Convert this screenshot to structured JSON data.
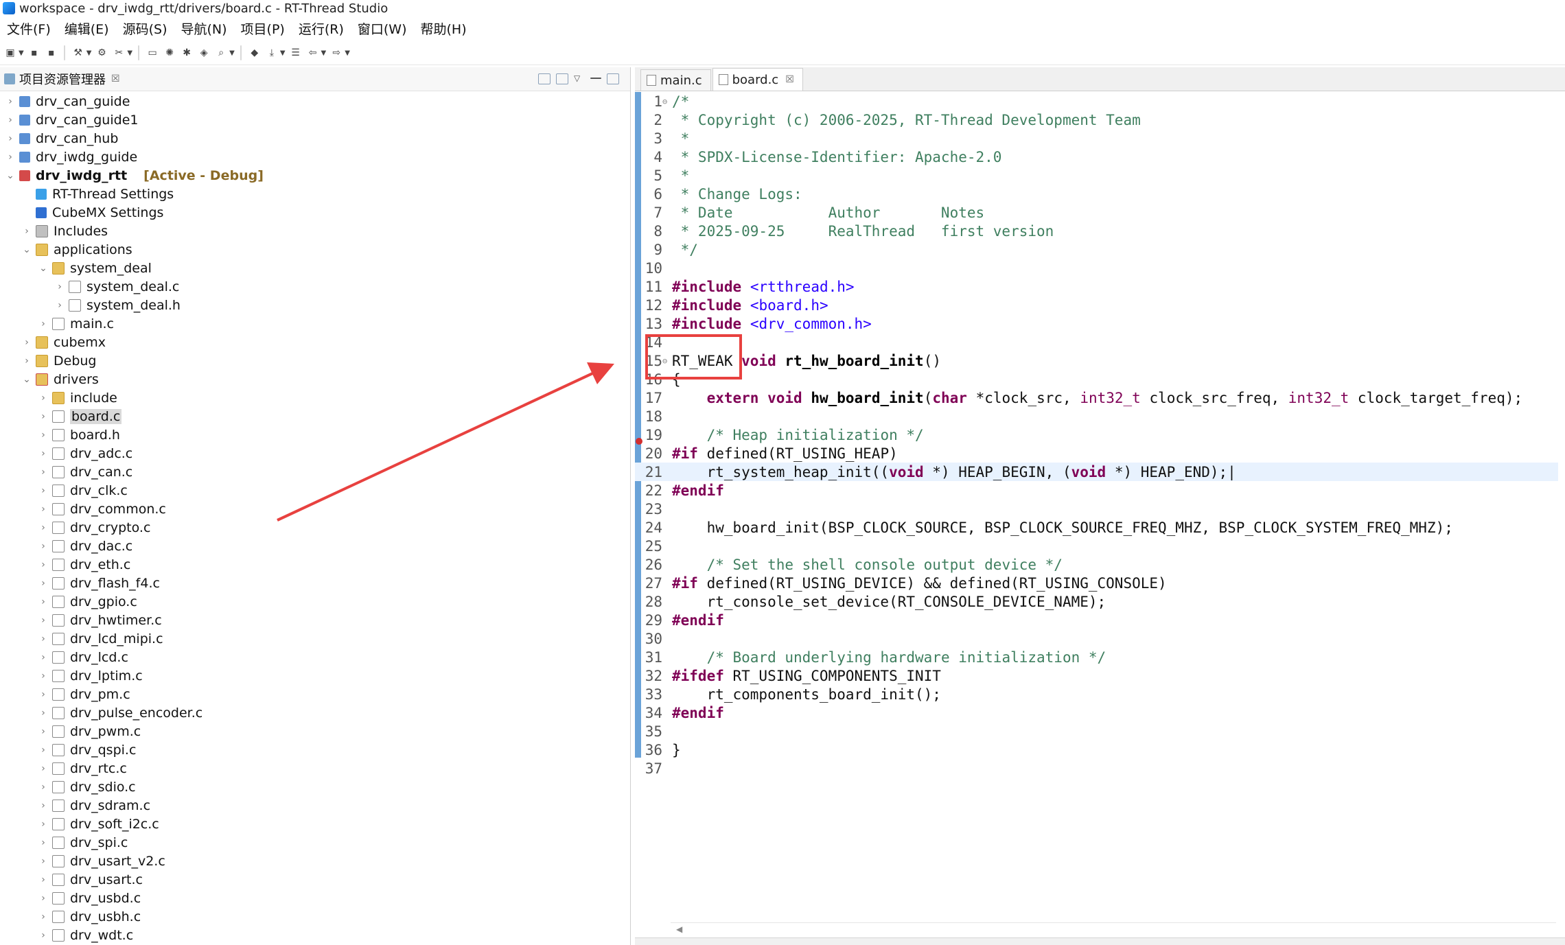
{
  "window": {
    "title": "workspace - drv_iwdg_rtt/drivers/board.c - RT-Thread Studio"
  },
  "menu": [
    "文件(F)",
    "编辑(E)",
    "源码(S)",
    "导航(N)",
    "项目(P)",
    "运行(R)",
    "窗口(W)",
    "帮助(H)"
  ],
  "explorer": {
    "title": "项目资源管理器",
    "close": "☒",
    "items": [
      {
        "label": "drv_can_guide",
        "depth": 0,
        "arrow": "›",
        "icon": "project"
      },
      {
        "label": "drv_can_guide1",
        "depth": 0,
        "arrow": "›",
        "icon": "project"
      },
      {
        "label": "drv_can_hub",
        "depth": 0,
        "arrow": "›",
        "icon": "project"
      },
      {
        "label": "drv_iwdg_guide",
        "depth": 0,
        "arrow": "›",
        "icon": "project"
      },
      {
        "label": "drv_iwdg_rtt",
        "depth": 0,
        "arrow": "⌄",
        "icon": "project-active",
        "tag": "[Active - Debug]"
      },
      {
        "label": "RT-Thread Settings",
        "depth": 1,
        "arrow": "",
        "icon": "settings"
      },
      {
        "label": "CubeMX Settings",
        "depth": 1,
        "arrow": "",
        "icon": "cube"
      },
      {
        "label": "Includes",
        "depth": 1,
        "arrow": "›",
        "icon": "includes"
      },
      {
        "label": "applications",
        "depth": 1,
        "arrow": "⌄",
        "icon": "folder"
      },
      {
        "label": "system_deal",
        "depth": 2,
        "arrow": "⌄",
        "icon": "folder"
      },
      {
        "label": "system_deal.c",
        "depth": 3,
        "arrow": "›",
        "icon": "cfile"
      },
      {
        "label": "system_deal.h",
        "depth": 3,
        "arrow": "›",
        "icon": "hfile"
      },
      {
        "label": "main.c",
        "depth": 2,
        "arrow": "›",
        "icon": "cfile"
      },
      {
        "label": "cubemx",
        "depth": 1,
        "arrow": "›",
        "icon": "folder"
      },
      {
        "label": "Debug",
        "depth": 1,
        "arrow": "›",
        "icon": "folder"
      },
      {
        "label": "drivers",
        "depth": 1,
        "arrow": "⌄",
        "icon": "folder-red"
      },
      {
        "label": "include",
        "depth": 2,
        "arrow": "›",
        "icon": "folder"
      },
      {
        "label": "board.c",
        "depth": 2,
        "arrow": "›",
        "icon": "cfile",
        "selected": true
      },
      {
        "label": "board.h",
        "depth": 2,
        "arrow": "›",
        "icon": "hfile"
      },
      {
        "label": "drv_adc.c",
        "depth": 2,
        "arrow": "›",
        "icon": "cfile"
      },
      {
        "label": "drv_can.c",
        "depth": 2,
        "arrow": "›",
        "icon": "cfile"
      },
      {
        "label": "drv_clk.c",
        "depth": 2,
        "arrow": "›",
        "icon": "cfile"
      },
      {
        "label": "drv_common.c",
        "depth": 2,
        "arrow": "›",
        "icon": "cfile"
      },
      {
        "label": "drv_crypto.c",
        "depth": 2,
        "arrow": "›",
        "icon": "cfile"
      },
      {
        "label": "drv_dac.c",
        "depth": 2,
        "arrow": "›",
        "icon": "cfile"
      },
      {
        "label": "drv_eth.c",
        "depth": 2,
        "arrow": "›",
        "icon": "cfile"
      },
      {
        "label": "drv_flash_f4.c",
        "depth": 2,
        "arrow": "›",
        "icon": "cfile"
      },
      {
        "label": "drv_gpio.c",
        "depth": 2,
        "arrow": "›",
        "icon": "cfile"
      },
      {
        "label": "drv_hwtimer.c",
        "depth": 2,
        "arrow": "›",
        "icon": "cfile"
      },
      {
        "label": "drv_lcd_mipi.c",
        "depth": 2,
        "arrow": "›",
        "icon": "cfile"
      },
      {
        "label": "drv_lcd.c",
        "depth": 2,
        "arrow": "›",
        "icon": "cfile"
      },
      {
        "label": "drv_lptim.c",
        "depth": 2,
        "arrow": "›",
        "icon": "cfile"
      },
      {
        "label": "drv_pm.c",
        "depth": 2,
        "arrow": "›",
        "icon": "cfile"
      },
      {
        "label": "drv_pulse_encoder.c",
        "depth": 2,
        "arrow": "›",
        "icon": "cfile"
      },
      {
        "label": "drv_pwm.c",
        "depth": 2,
        "arrow": "›",
        "icon": "cfile"
      },
      {
        "label": "drv_qspi.c",
        "depth": 2,
        "arrow": "›",
        "icon": "cfile"
      },
      {
        "label": "drv_rtc.c",
        "depth": 2,
        "arrow": "›",
        "icon": "cfile"
      },
      {
        "label": "drv_sdio.c",
        "depth": 2,
        "arrow": "›",
        "icon": "cfile"
      },
      {
        "label": "drv_sdram.c",
        "depth": 2,
        "arrow": "›",
        "icon": "cfile"
      },
      {
        "label": "drv_soft_i2c.c",
        "depth": 2,
        "arrow": "›",
        "icon": "cfile"
      },
      {
        "label": "drv_spi.c",
        "depth": 2,
        "arrow": "›",
        "icon": "cfile"
      },
      {
        "label": "drv_usart_v2.c",
        "depth": 2,
        "arrow": "›",
        "icon": "cfile"
      },
      {
        "label": "drv_usart.c",
        "depth": 2,
        "arrow": "›",
        "icon": "cfile"
      },
      {
        "label": "drv_usbd.c",
        "depth": 2,
        "arrow": "›",
        "icon": "cfile"
      },
      {
        "label": "drv_usbh.c",
        "depth": 2,
        "arrow": "›",
        "icon": "cfile"
      },
      {
        "label": "drv_wdt.c",
        "depth": 2,
        "arrow": "›",
        "icon": "cfile"
      }
    ]
  },
  "editor": {
    "tabs": [
      {
        "label": "main.c",
        "active": false
      },
      {
        "label": "board.c",
        "active": true,
        "close": "☒"
      }
    ],
    "lines": [
      {
        "n": "1",
        "fold": "⊖",
        "html": "<span class=\"cm\">/*</span>"
      },
      {
        "n": "2",
        "html": "<span class=\"cm\"> * Copyright (c) 2006-2025, RT-Thread Development Team</span>"
      },
      {
        "n": "3",
        "html": "<span class=\"cm\"> *</span>"
      },
      {
        "n": "4",
        "html": "<span class=\"cm\"> * SPDX-License-Identifier: Apache-2.0</span>"
      },
      {
        "n": "5",
        "html": "<span class=\"cm\"> *</span>"
      },
      {
        "n": "6",
        "html": "<span class=\"cm\"> * Change Logs:</span>"
      },
      {
        "n": "7",
        "html": "<span class=\"cm\"> * Date           Author       Notes</span>"
      },
      {
        "n": "8",
        "html": "<span class=\"cm\"> * 2025-09-25     RealThread   first version</span>"
      },
      {
        "n": "9",
        "html": "<span class=\"cm\"> */</span>"
      },
      {
        "n": "10",
        "html": ""
      },
      {
        "n": "11",
        "html": "<span class=\"pp\">#include</span> <span class=\"str\">&lt;rtthread.h&gt;</span>"
      },
      {
        "n": "12",
        "html": "<span class=\"pp\">#include</span> <span class=\"str\">&lt;board.h&gt;</span>"
      },
      {
        "n": "13",
        "html": "<span class=\"pp\">#include</span> <span class=\"str\">&lt;drv_common.h&gt;</span>"
      },
      {
        "n": "14",
        "html": ""
      },
      {
        "n": "15",
        "fold": "⊖",
        "html": "RT_WEAK <span class=\"kw\">void</span> <span class=\"fn\">rt_hw_board_init</span>()"
      },
      {
        "n": "16",
        "html": "{"
      },
      {
        "n": "17",
        "html": "    <span class=\"kw\">extern</span> <span class=\"kw\">void</span> <span class=\"fn\">hw_board_init</span>(<span class=\"kw\">char</span> *clock_src, <span class=\"ty\">int32_t</span> clock_src_freq, <span class=\"ty\">int32_t</span> clock_target_freq);"
      },
      {
        "n": "18",
        "html": ""
      },
      {
        "n": "19",
        "html": "    <span class=\"cm\">/* Heap initialization */</span>"
      },
      {
        "n": "20",
        "html": "<span class=\"pp\">#if</span> defined(RT_USING_HEAP)"
      },
      {
        "n": "21",
        "hl": true,
        "html": "    rt_system_heap_init((<span class=\"kw\">void</span> *) HEAP_BEGIN, (<span class=\"kw\">void</span> *) HEAP_END);|"
      },
      {
        "n": "22",
        "html": "<span class=\"pp\">#endif</span>"
      },
      {
        "n": "23",
        "html": ""
      },
      {
        "n": "24",
        "html": "    hw_board_init(BSP_CLOCK_SOURCE, BSP_CLOCK_SOURCE_FREQ_MHZ, BSP_CLOCK_SYSTEM_FREQ_MHZ);"
      },
      {
        "n": "25",
        "html": ""
      },
      {
        "n": "26",
        "html": "    <span class=\"cm\">/* Set the shell console output device */</span>"
      },
      {
        "n": "27",
        "html": "<span class=\"pp\">#if</span> defined(RT_USING_DEVICE) &amp;&amp; defined(RT_USING_CONSOLE)"
      },
      {
        "n": "28",
        "html": "    rt_console_set_device(RT_CONSOLE_DEVICE_NAME);"
      },
      {
        "n": "29",
        "html": "<span class=\"pp\">#endif</span>"
      },
      {
        "n": "30",
        "html": ""
      },
      {
        "n": "31",
        "html": "    <span class=\"cm\">/* Board underlying hardware initialization */</span>"
      },
      {
        "n": "32",
        "html": "<span class=\"pp\">#ifdef</span> RT_USING_COMPONENTS_INIT"
      },
      {
        "n": "33",
        "html": "    rt_components_board_init();"
      },
      {
        "n": "34",
        "html": "<span class=\"pp\">#endif</span>"
      },
      {
        "n": "35",
        "html": ""
      },
      {
        "n": "36",
        "html": "}"
      },
      {
        "n": "37",
        "html": ""
      }
    ]
  },
  "colors": {
    "keyword": "#7f0055",
    "comment": "#3f7f5f",
    "string": "#2a00ff",
    "annotation": "#e8413f",
    "gutter": "#6aa3d8"
  }
}
